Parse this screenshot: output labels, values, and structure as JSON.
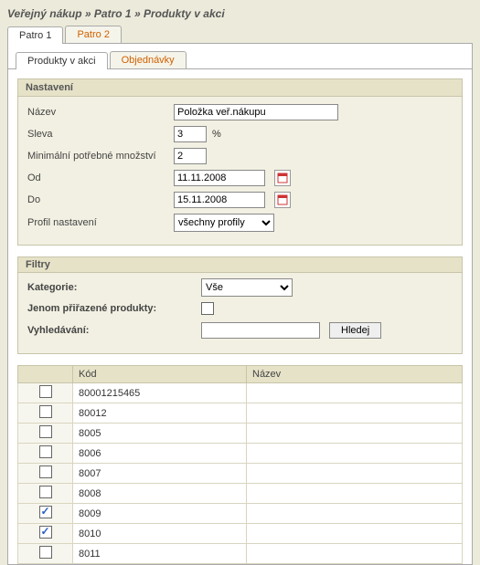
{
  "breadcrumb": "Veřejný nákup » Patro 1 » Produkty v akci",
  "tabs": {
    "outer": [
      {
        "label": "Patro 1",
        "active": true
      },
      {
        "label": "Patro 2",
        "active": false
      }
    ],
    "inner": [
      {
        "label": "Produkty v akci",
        "active": true
      },
      {
        "label": "Objednávky",
        "active": false
      }
    ]
  },
  "settings": {
    "legend": "Nastavení",
    "name_label": "Název",
    "name_value": "Položka veř.nákupu",
    "sleva_label": "Sleva",
    "sleva_value": "3",
    "sleva_unit": "%",
    "minqty_label": "Minimální potřebné množství",
    "minqty_value": "2",
    "od_label": "Od",
    "od_value": "11.11.2008",
    "do_label": "Do",
    "do_value": "15.11.2008",
    "profil_label": "Profil nastavení",
    "profil_value": "všechny profily"
  },
  "filters": {
    "legend": "Filtry",
    "kategorie_label": "Kategorie:",
    "kategorie_value": "Vše",
    "assigned_label": "Jenom přiřazené produkty:",
    "assigned_checked": false,
    "search_label": "Vyhledávání:",
    "search_value": "",
    "search_button": "Hledej"
  },
  "table": {
    "headers": {
      "chk": "",
      "kod": "Kód",
      "nazev": "Název"
    },
    "rows": [
      {
        "checked": false,
        "kod": "80001215465",
        "nazev": ""
      },
      {
        "checked": false,
        "kod": "80012",
        "nazev": ""
      },
      {
        "checked": false,
        "kod": "8005",
        "nazev": ""
      },
      {
        "checked": false,
        "kod": "8006",
        "nazev": ""
      },
      {
        "checked": false,
        "kod": "8007",
        "nazev": ""
      },
      {
        "checked": false,
        "kod": "8008",
        "nazev": ""
      },
      {
        "checked": true,
        "kod": "8009",
        "nazev": ""
      },
      {
        "checked": true,
        "kod": "8010",
        "nazev": ""
      },
      {
        "checked": false,
        "kod": "8011",
        "nazev": ""
      }
    ]
  }
}
